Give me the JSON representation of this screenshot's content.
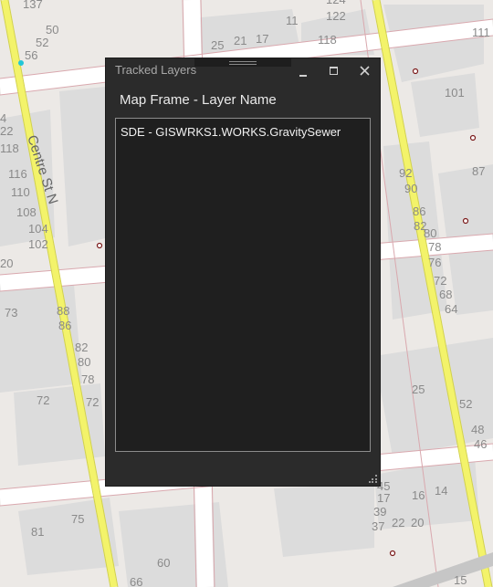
{
  "map": {
    "street_label": "Centre St N",
    "parcel_numbers": [
      "137",
      "50",
      "52",
      "56",
      "11",
      "124",
      "122",
      "25",
      "21",
      "17",
      "118",
      "111",
      "101",
      "4",
      "22",
      "118",
      "116",
      "110",
      "108",
      "104",
      "102",
      "20",
      "73",
      "88",
      "86",
      "82",
      "80",
      "78",
      "72",
      "72",
      "92",
      "90",
      "87",
      "86",
      "82",
      "80",
      "78",
      "76",
      "72",
      "68",
      "64",
      "25",
      "52",
      "48",
      "46",
      "45",
      "17",
      "16",
      "14",
      "39",
      "37",
      "22",
      "20",
      "75",
      "81",
      "15",
      "66",
      "60"
    ]
  },
  "window": {
    "title": "Tracked Layers",
    "column_header": "Map Frame - Layer Name",
    "layers": [
      "SDE - GISWRKS1.WORKS.GravitySewer"
    ]
  },
  "colors": {
    "road_yellow": "#f3f36a",
    "parcel_line": "#d9a8ae",
    "panel_bg": "#2b2b2b"
  },
  "icons": [
    "minimize-icon",
    "maximize-icon",
    "close-icon",
    "resize-grip-icon"
  ]
}
